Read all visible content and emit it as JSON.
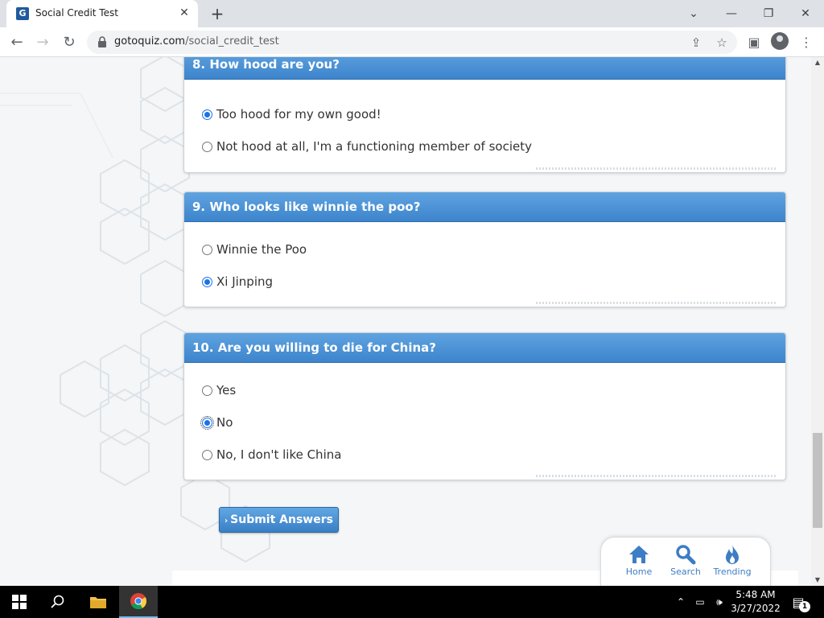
{
  "browser": {
    "tab_title": "Social Credit Test",
    "favicon_letter": "G",
    "url_domain": "gotoquiz.com",
    "url_path": "/social_credit_test"
  },
  "questions": [
    {
      "title": "8. How hood are you?",
      "answers": [
        {
          "label": "Too hood for my own good!",
          "checked": true
        },
        {
          "label": "Not hood at all, I'm a functioning member of society",
          "checked": false
        }
      ]
    },
    {
      "title": "9. Who looks like winnie the poo?",
      "answers": [
        {
          "label": "Winnie the Poo",
          "checked": false
        },
        {
          "label": "Xi Jinping",
          "checked": true
        }
      ]
    },
    {
      "title": "10. Are you willing to die for China?",
      "answers": [
        {
          "label": "Yes",
          "checked": false
        },
        {
          "label": "No",
          "checked": true
        },
        {
          "label": "No, I don't like China",
          "checked": false
        }
      ]
    }
  ],
  "submit_label": "Submit Answers",
  "site_nav": {
    "home": "Home",
    "search": "Search",
    "trending": "Trending"
  },
  "taskbar": {
    "time": "5:48 AM",
    "date": "3/27/2022",
    "notification_count": "1"
  },
  "colors": {
    "accent": "#3d84cc",
    "nav_icon": "#3d7dc4"
  }
}
